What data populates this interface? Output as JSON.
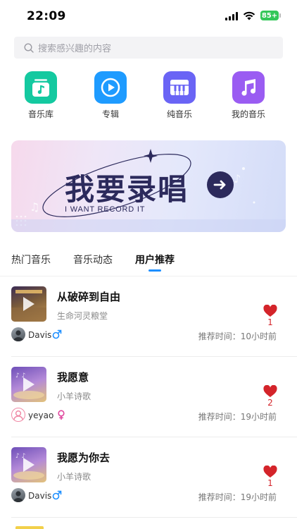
{
  "status_bar": {
    "time": "22:09",
    "battery": "85+"
  },
  "search": {
    "placeholder": "搜索感兴趣的内容"
  },
  "quick_entries": [
    {
      "label": "音乐库",
      "icon": "music-library-icon",
      "color": "#14c9a0"
    },
    {
      "label": "专辑",
      "icon": "album-play-icon",
      "color": "#1e9bff"
    },
    {
      "label": "纯音乐",
      "icon": "piano-icon",
      "color": "#6a64f5"
    },
    {
      "label": "我的音乐",
      "icon": "music-note-icon",
      "color": "#9a5cf2"
    }
  ],
  "banner": {
    "title": "我要录唱",
    "subtitle": "I WANT RECORD IT"
  },
  "tabs": [
    {
      "label": "热门音乐",
      "active": false
    },
    {
      "label": "音乐动态",
      "active": false
    },
    {
      "label": "用户推荐",
      "active": true
    }
  ],
  "songs": [
    {
      "title": "从破碎到自由",
      "artist": "生命河灵粮堂",
      "likes": "1",
      "user": "Davis",
      "gender": "male",
      "time": "推荐时间：10小时前"
    },
    {
      "title": "我愿意",
      "artist": "小羊诗歌",
      "likes": "2",
      "user": "yeyao",
      "gender": "female",
      "time": "推荐时间：19小时前"
    },
    {
      "title": "我愿为你去",
      "artist": "小羊诗歌",
      "likes": "1",
      "user": "Davis",
      "gender": "male",
      "time": "推荐时间：19小时前"
    }
  ],
  "colors": {
    "accent": "#1e8fff",
    "like": "#d4242a",
    "male": "#1e8fff",
    "female": "#e0479e"
  }
}
